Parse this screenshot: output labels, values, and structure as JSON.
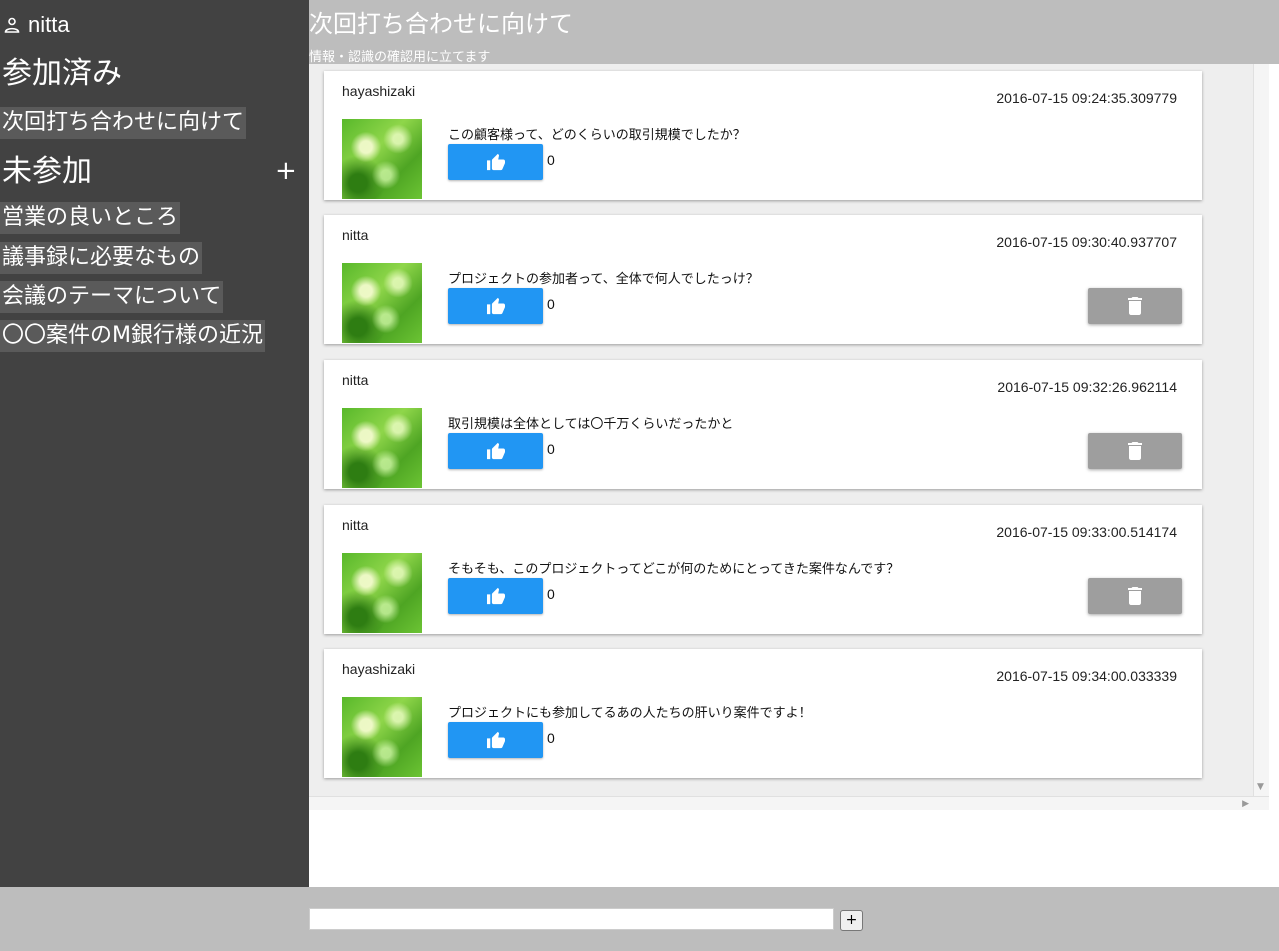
{
  "header": {
    "title": "次回打ち合わせに向けて",
    "subtitle": "情報・認識の確認用に立てます"
  },
  "sidebar": {
    "user": {
      "icon": "person-icon",
      "name": "nitta"
    },
    "joined_heading": "参加済み",
    "joined_rooms": [
      {
        "label": "次回打ち合わせに向けて"
      }
    ],
    "unjoined_heading": "未参加",
    "add_label": "+",
    "unjoined_rooms": [
      {
        "label": "営業の良いところ"
      },
      {
        "label": "議事録に必要なもの"
      },
      {
        "label": "会議のテーマについて"
      },
      {
        "label": "〇〇案件のM銀行様の近況"
      }
    ]
  },
  "messages": [
    {
      "author": "hayashizaki",
      "timestamp": "2016-07-15 09:24:35.309779",
      "text": "この顧客様って、どのくらいの取引規模でしたか？",
      "likes": "0",
      "deletable": false
    },
    {
      "author": "nitta",
      "timestamp": "2016-07-15 09:30:40.937707",
      "text": "プロジェクトの参加者って、全体で何人でしたっけ？",
      "likes": "0",
      "deletable": true
    },
    {
      "author": "nitta",
      "timestamp": "2016-07-15 09:32:26.962114",
      "text": "取引規模は全体としては〇千万くらいだったかと",
      "likes": "0",
      "deletable": true
    },
    {
      "author": "nitta",
      "timestamp": "2016-07-15 09:33:00.514174",
      "text": "そもそも、このプロジェクトってどこが何のためにとってきた案件なんです？",
      "likes": "0",
      "deletable": true
    },
    {
      "author": "hayashizaki",
      "timestamp": "2016-07-15 09:34:00.033339",
      "text": "プロジェクトにも参加してるあの人たちの肝いり案件ですよ！",
      "likes": "0",
      "deletable": false
    }
  ],
  "icons": {
    "like": "thumbs-up-icon",
    "delete": "trash-icon",
    "user": "person-icon"
  },
  "colors": {
    "sidebar": "#424242",
    "header": "#bdbdbd",
    "like_button": "#2196f3",
    "delete_button": "#9e9e9e"
  },
  "footer": {
    "input_value": "",
    "send_label": "+"
  }
}
